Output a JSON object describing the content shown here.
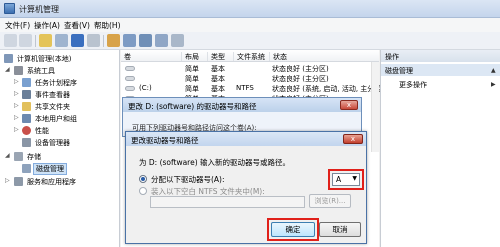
{
  "window": {
    "title": "计算机管理"
  },
  "menu": [
    "文件(F)",
    "操作(A)",
    "查看(V)",
    "帮助(H)"
  ],
  "tree": {
    "root": "计算机管理(本地)",
    "items": [
      "系统工具",
      "任务计划程序",
      "事件查看器",
      "共享文件夹",
      "本地用户和组",
      "性能",
      "设备管理器",
      "存储",
      "磁盘管理",
      "服务和应用程序"
    ]
  },
  "list": {
    "columns": [
      "卷",
      "布局",
      "类型",
      "文件系统",
      "状态"
    ],
    "rows": [
      {
        "vol": "",
        "layout": "简单",
        "type": "基本",
        "fs": "",
        "status": "状态良好 (主分区)"
      },
      {
        "vol": "",
        "layout": "简单",
        "type": "基本",
        "fs": "",
        "status": "状态良好 (主分区)"
      },
      {
        "vol": "(C:)",
        "layout": "简单",
        "type": "基本",
        "fs": "NTFS",
        "status": "状态良好 (系统, 启动, 活动, 主分区)"
      },
      {
        "vol": "",
        "layout": "简单",
        "type": "基本",
        "fs": "",
        "status": "状态良好 (主分区)"
      }
    ]
  },
  "actions": {
    "header": "操作",
    "section": "磁盘管理",
    "more": "更多操作"
  },
  "dialog_bg": {
    "title": "更改 D: (software) 的驱动器号和路径",
    "text": "可用下列驱动器号和路径访问这个卷(A):"
  },
  "dialog_fg": {
    "title": "更改驱动器号和路径",
    "prompt": "为 D: (software) 输入新的驱动器号或路径。",
    "option_assign": "分配以下驱动器号(A):",
    "option_mount": "装入以下空白 NTFS 文件夹中(M):",
    "drive_letter": "A",
    "browse_label": "浏览(R)...",
    "ok_label": "确定",
    "cancel_label": "取消",
    "close_glyph": "x"
  },
  "colors": {
    "highlight": "#e0201a",
    "accent": "#4a72a6"
  }
}
